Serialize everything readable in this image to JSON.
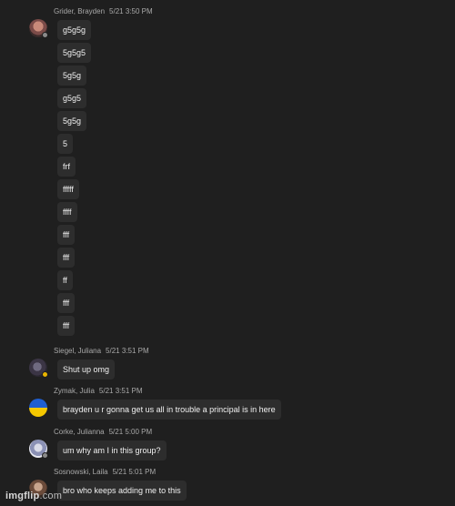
{
  "messages": {
    "g1": {
      "author": "Grider, Brayden",
      "time": "5/21 3:50 PM",
      "lines": [
        "g5g5g",
        "5g5g5",
        "5g5g",
        "g5g5",
        "5g5g",
        "5",
        "frf",
        "fffff",
        "ffff",
        "fff",
        "fff",
        "ff",
        "fff",
        "fff"
      ]
    },
    "g2": {
      "author": "Siegel, Juliana",
      "time": "5/21 3:51 PM",
      "lines": [
        "Shut up omg"
      ]
    },
    "g3": {
      "author": "Zymak, Julia",
      "time": "5/21 3:51 PM",
      "lines": [
        "brayden u r gonna get us all in trouble a principal is in here"
      ]
    },
    "g4": {
      "author": "Corke, Julianna",
      "time": "5/21 5:00 PM",
      "lines": [
        "um why am I in this group?"
      ]
    },
    "g5": {
      "author": "Sosnowski, Laila",
      "time": "5/21 5:01 PM",
      "lines": [
        "bro who keeps adding me to this"
      ]
    }
  },
  "avatars": {
    "g1": "photo-avatar-reddish",
    "g2": "photo-avatar-dark",
    "g3": "flag-avatar-blue-yellow",
    "g4": "photo-avatar-light",
    "g5": "photo-avatar-brown"
  },
  "colors": {
    "background": "#1f1f1f",
    "bubble": "#2d2d2d",
    "status_offline": "#8a8a8a",
    "status_away": "#e8b400"
  },
  "watermark": {
    "brand": "imgflip",
    "suffix": ".com"
  }
}
